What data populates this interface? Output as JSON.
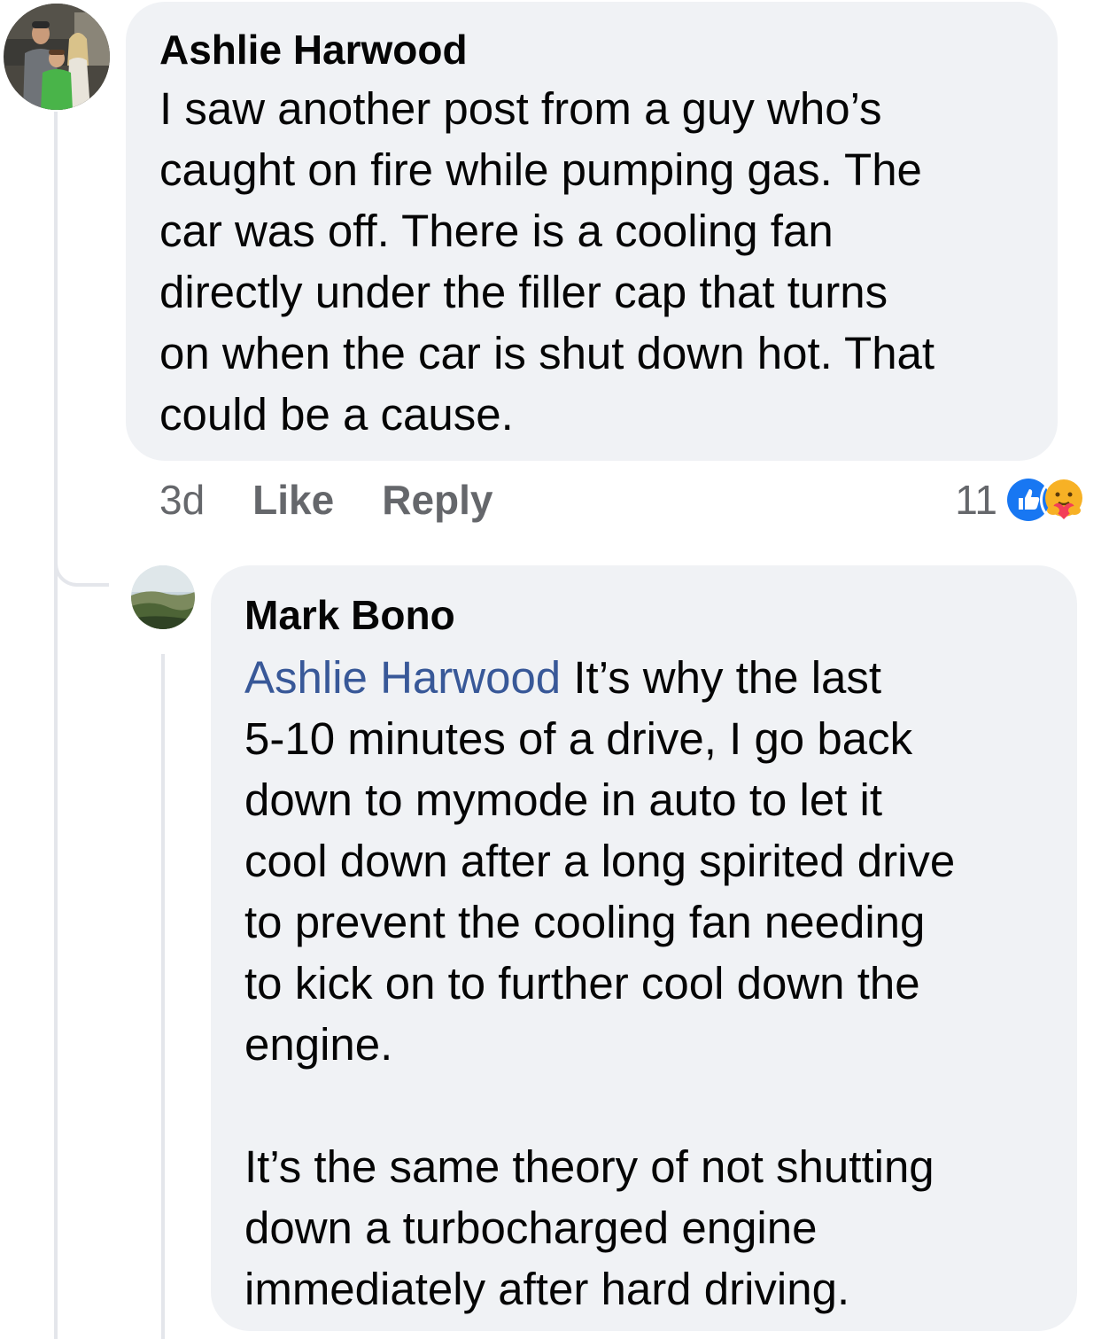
{
  "comments": [
    {
      "author": "Ashlie Harwood",
      "text": "I saw another post from a guy who’s\ncaught on fire while pumping gas. The\ncar was off. There is a cooling fan\ndirectly under the filler cap that turns\non when the car is shut down hot. That\ncould be a cause.",
      "time": "3d",
      "like_label": "Like",
      "reply_label": "Reply",
      "reaction_count": "11",
      "reactions": [
        "like-icon",
        "care-icon"
      ],
      "avatar": "family-photo-avatar"
    }
  ],
  "reply": {
    "author": "Mark Bono",
    "mention": "Ashlie Harwood",
    "text": " It’s why the last\n5-10 minutes of a drive, I go back\ndown to mymode in auto to let it\ncool down after a long spirited drive\nto prevent the cooling fan needing\nto kick on to further cool down the\nengine.\n\nIt’s the same theory of not shutting\ndown a turbocharged engine\nimmediately after hard driving.",
    "avatar": "landscape-photo-avatar"
  },
  "colors": {
    "bubble": "#f0f2f5",
    "mention": "#385898",
    "meta": "#65676b",
    "like_blue": "#1877f2",
    "thread_line": "#e4e6eb"
  }
}
